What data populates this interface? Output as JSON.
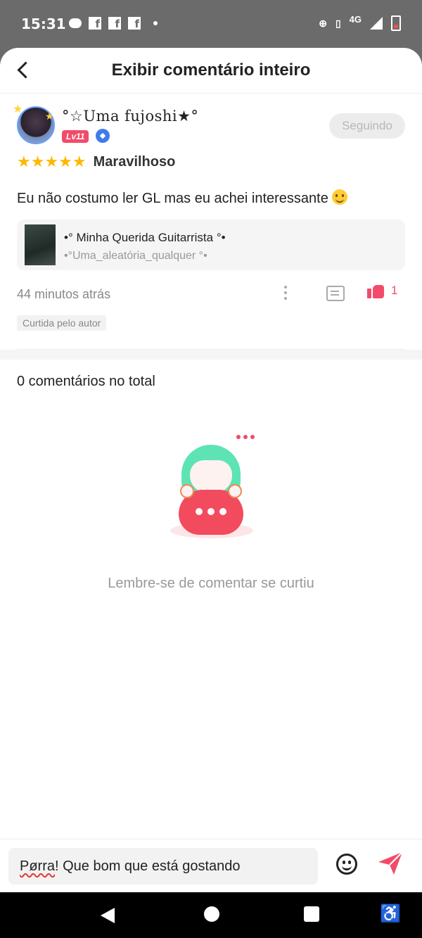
{
  "status_bar": {
    "time": "15:31",
    "network": "4G",
    "icons": [
      "chat-icon",
      "facebook-icon",
      "facebook-icon",
      "facebook-icon",
      "notification-dot",
      "data-saver-icon",
      "vibrate-icon",
      "signal-icon",
      "battery-icon"
    ]
  },
  "header": {
    "title": "Exibir comentário inteiro",
    "back_icon": "chevron-left-icon"
  },
  "review": {
    "username": "°☆Uma fujoshi★°",
    "level": "Lv11",
    "follow_label": "Seguindo",
    "stars": "★★★★★",
    "rating_count": 5,
    "rating_label": "Maravilhoso",
    "text": "Eu não costumo ler GL mas eu achei interessante",
    "book": {
      "title": "•° Minha Querida Guitarrista °•",
      "author": "•°Uma_aleatória_qualquer °•"
    },
    "time": "44 minutos atrás",
    "like_count": "1",
    "author_liked_label": "Curtida pelo autor"
  },
  "comments": {
    "total_label": "0 comentários no total",
    "empty_text": "Lembre-se de comentar se curtiu"
  },
  "input": {
    "value_part1": "Pørra",
    "value_part2": "! Que bom que está gostando"
  },
  "colors": {
    "accent": "#f24b6a",
    "star": "#ffb800",
    "mascot_hair": "#5ee3b5"
  }
}
